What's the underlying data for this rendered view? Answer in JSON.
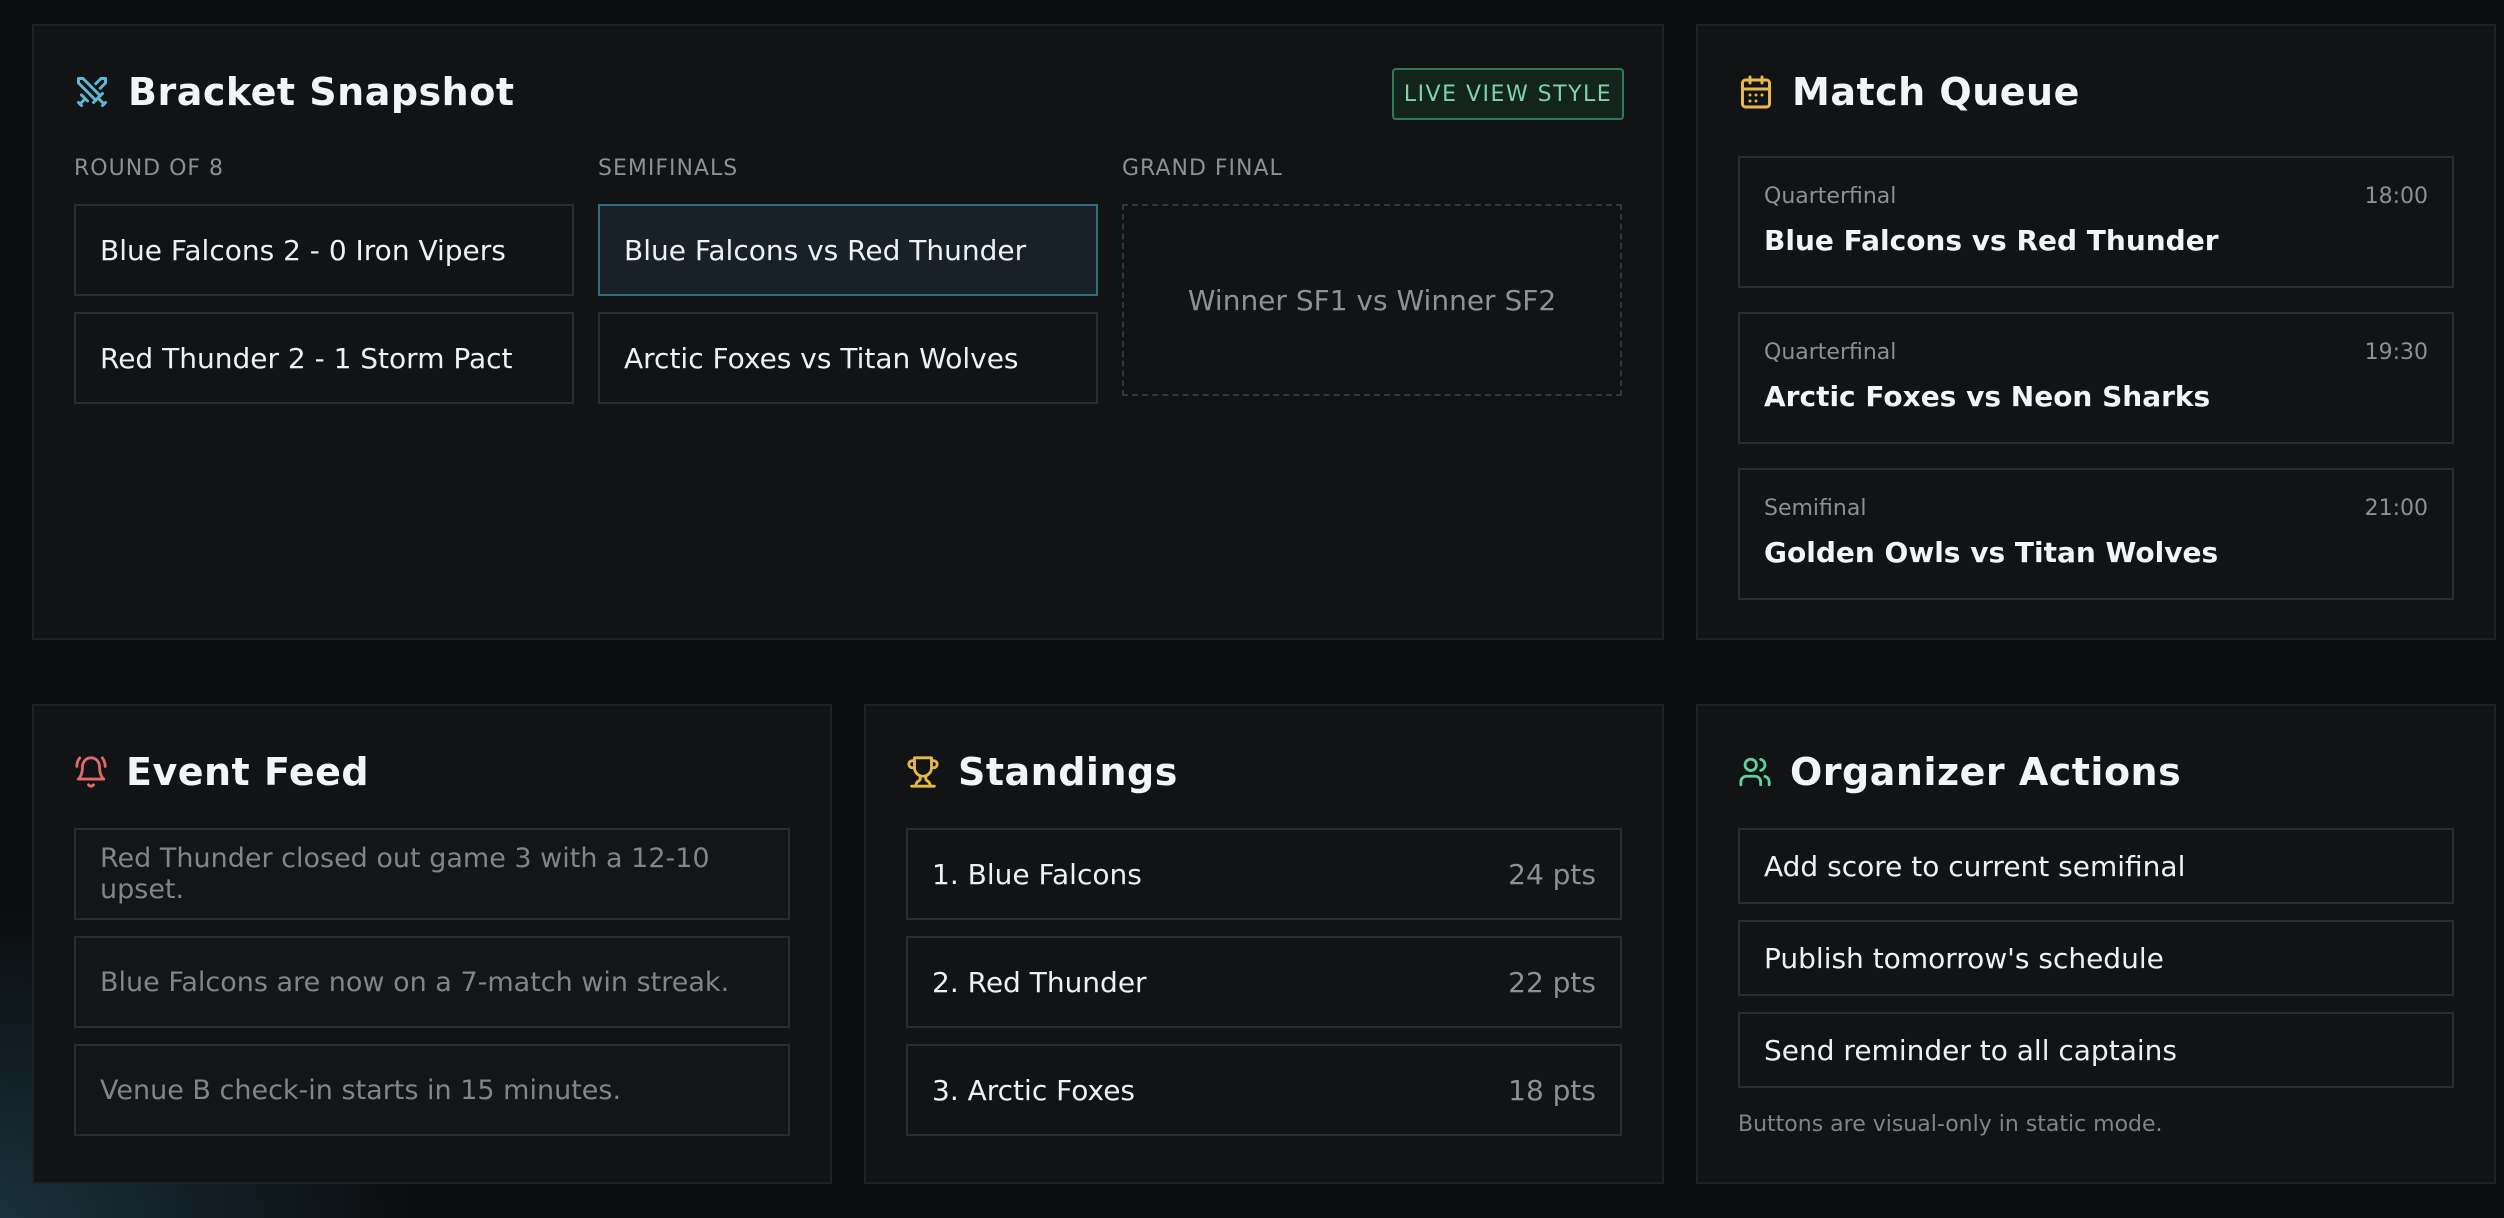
{
  "bracket": {
    "title": "Bracket Snapshot",
    "badge": "LIVE VIEW STYLE",
    "columns": [
      {
        "label": "ROUND OF 8",
        "matches": [
          "Blue Falcons 2 - 0 Iron Vipers",
          "Red Thunder 2 - 1 Storm Pact"
        ]
      },
      {
        "label": "SEMIFINALS",
        "matches": [
          "Blue Falcons vs Red Thunder",
          "Arctic Foxes vs Titan Wolves"
        ]
      },
      {
        "label": "GRAND FINAL",
        "matches": [
          "Winner SF1 vs Winner SF2"
        ]
      }
    ]
  },
  "queue": {
    "title": "Match Queue",
    "items": [
      {
        "stage": "Quarterfinal",
        "time": "18:00",
        "teams": "Blue Falcons vs Red Thunder"
      },
      {
        "stage": "Quarterfinal",
        "time": "19:30",
        "teams": "Arctic Foxes vs Neon Sharks"
      },
      {
        "stage": "Semifinal",
        "time": "21:00",
        "teams": "Golden Owls vs Titan Wolves"
      }
    ]
  },
  "feed": {
    "title": "Event Feed",
    "items": [
      "Red Thunder closed out game 3 with a 12-10 upset.",
      "Blue Falcons are now on a 7-match win streak.",
      "Venue B check-in starts in 15 minutes."
    ]
  },
  "standings": {
    "title": "Standings",
    "rows": [
      {
        "team": "1. Blue Falcons",
        "pts": "24 pts"
      },
      {
        "team": "2. Red Thunder",
        "pts": "22 pts"
      },
      {
        "team": "3. Arctic Foxes",
        "pts": "18 pts"
      }
    ]
  },
  "actions": {
    "title": "Organizer Actions",
    "buttons": [
      "Add score to current semifinal",
      "Publish tomorrow's schedule",
      "Send reminder to all captains"
    ],
    "note": "Buttons are visual-only in static mode."
  },
  "icons": {
    "bracket": "crossed-swords-icon",
    "queue": "calendar-icon",
    "feed": "bell-icon",
    "standings": "trophy-icon",
    "actions": "users-icon"
  },
  "colors": {
    "bracket_icon": "#5bb8d6",
    "queue_icon": "#e8b84a",
    "feed_icon": "#e06a6a",
    "standings_icon": "#e8b84a",
    "actions_icon": "#5fd39a",
    "badge": "#7fd3a8",
    "active_card": "#2f6e7a"
  }
}
